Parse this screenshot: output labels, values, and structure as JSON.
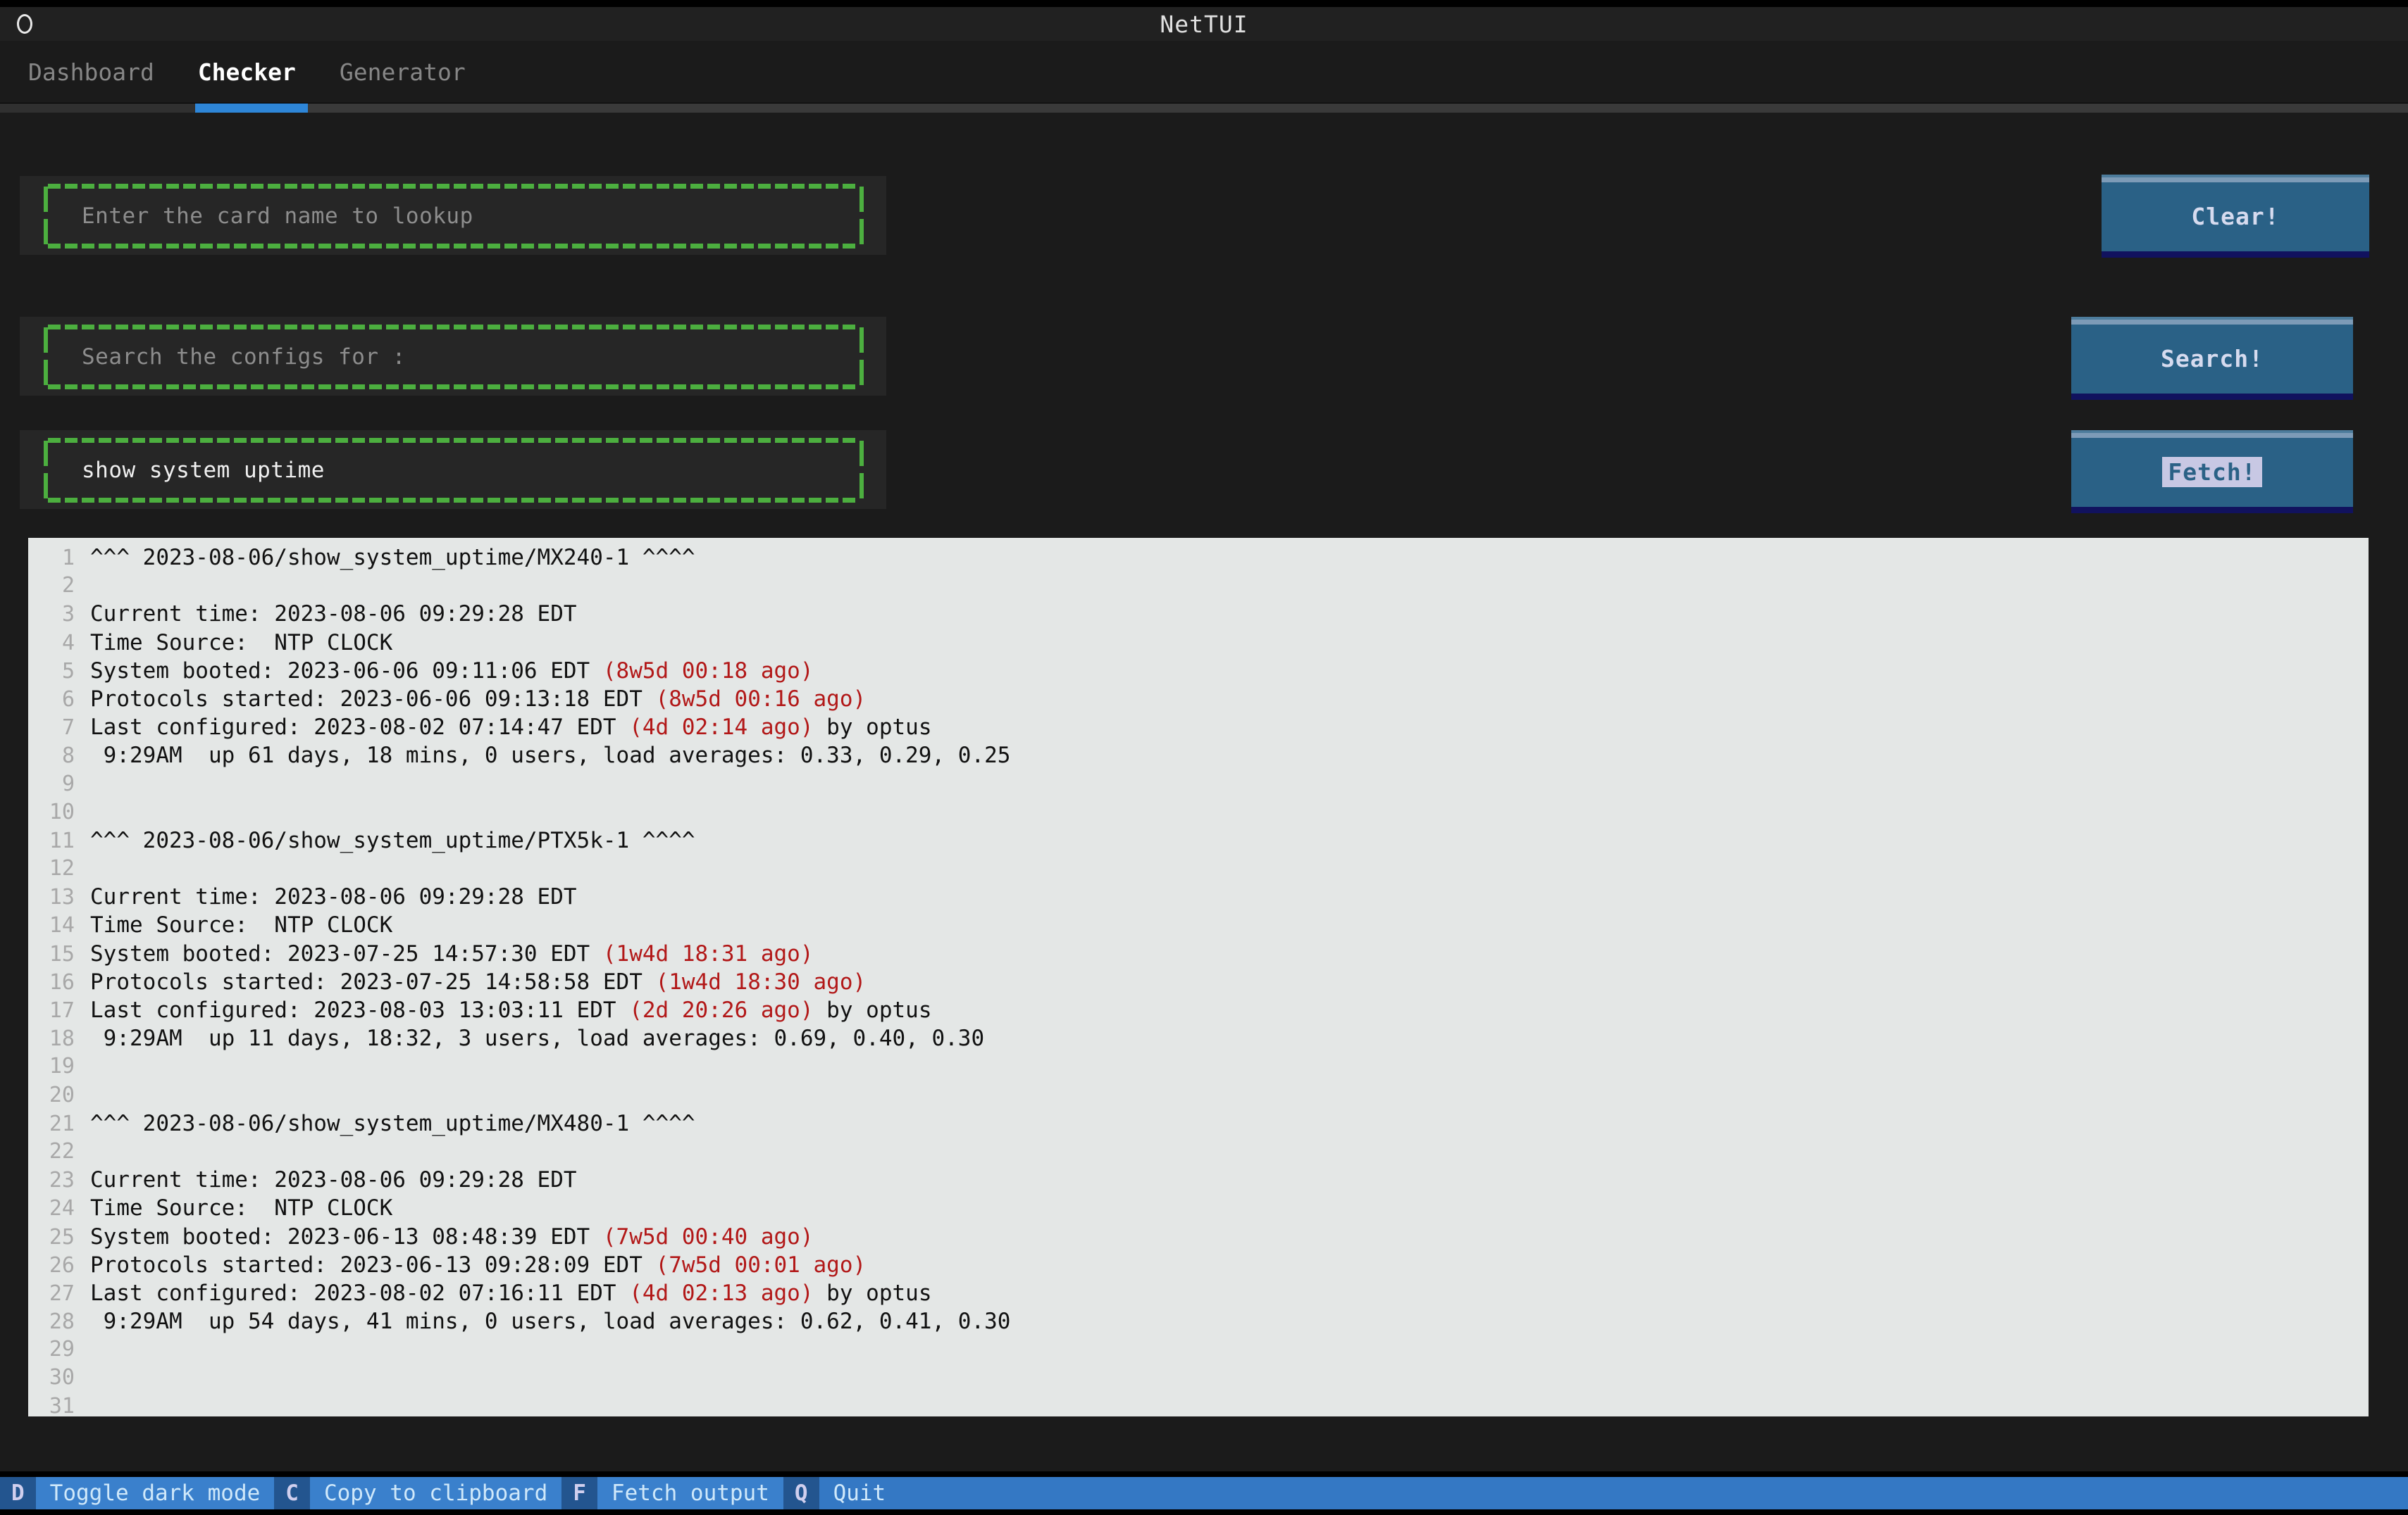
{
  "window": {
    "title": "NetTUI",
    "menu_icon": "circle-icon"
  },
  "tabs": [
    {
      "label": "Dashboard",
      "active": false
    },
    {
      "label": "Checker",
      "active": true
    },
    {
      "label": "Generator",
      "active": false
    }
  ],
  "inputs": [
    {
      "name": "card-name-input",
      "placeholder": "Enter the card name to lookup",
      "value": "",
      "is_placeholder": true
    },
    {
      "name": "config-search-input",
      "placeholder": "Search the configs for :",
      "value": "",
      "is_placeholder": true
    },
    {
      "name": "command-input",
      "placeholder": "",
      "value": "show system uptime",
      "is_placeholder": false
    }
  ],
  "buttons": [
    {
      "label": "Clear!",
      "highlighted": false
    },
    {
      "label": "Search!",
      "highlighted": false
    },
    {
      "label": "Fetch!",
      "highlighted": true
    }
  ],
  "colors": {
    "accent_blue": "#2e86d8",
    "button_blue": "#2a6186",
    "border_green": "#4caf3f",
    "footer_blue": "#3478c4",
    "output_bg": "#e4e7e6",
    "red_annotation": "#b21818"
  },
  "output": {
    "lines": [
      {
        "n": "1",
        "segs": [
          {
            "t": "^^^ 2023-08-06/show_system_uptime/MX240-1 ^^^^",
            "c": "n"
          }
        ]
      },
      {
        "n": "2",
        "segs": []
      },
      {
        "n": "3",
        "segs": [
          {
            "t": "Current time: 2023-08-06 09:29:28 EDT",
            "c": "n"
          }
        ]
      },
      {
        "n": "4",
        "segs": [
          {
            "t": "Time Source:  NTP CLOCK",
            "c": "n"
          }
        ]
      },
      {
        "n": "5",
        "segs": [
          {
            "t": "System booted: 2023-06-06 09:11:06 EDT ",
            "c": "n"
          },
          {
            "t": "(8w5d 00:18 ago)",
            "c": "r"
          }
        ]
      },
      {
        "n": "6",
        "segs": [
          {
            "t": "Protocols started: 2023-06-06 09:13:18 EDT ",
            "c": "n"
          },
          {
            "t": "(8w5d 00:16 ago)",
            "c": "r"
          }
        ]
      },
      {
        "n": "7",
        "segs": [
          {
            "t": "Last configured: 2023-08-02 07:14:47 EDT ",
            "c": "n"
          },
          {
            "t": "(4d 02:14 ago)",
            "c": "r"
          },
          {
            "t": " by optus",
            "c": "n"
          }
        ]
      },
      {
        "n": "8",
        "segs": [
          {
            "t": " 9:29AM  up 61 days, 18 mins, 0 users, load averages: 0.33, 0.29, 0.25",
            "c": "n"
          }
        ]
      },
      {
        "n": "9",
        "segs": []
      },
      {
        "n": "10",
        "segs": []
      },
      {
        "n": "11",
        "segs": [
          {
            "t": "^^^ 2023-08-06/show_system_uptime/PTX5k-1 ^^^^",
            "c": "n"
          }
        ]
      },
      {
        "n": "12",
        "segs": []
      },
      {
        "n": "13",
        "segs": [
          {
            "t": "Current time: 2023-08-06 09:29:28 EDT",
            "c": "n"
          }
        ]
      },
      {
        "n": "14",
        "segs": [
          {
            "t": "Time Source:  NTP CLOCK",
            "c": "n"
          }
        ]
      },
      {
        "n": "15",
        "segs": [
          {
            "t": "System booted: 2023-07-25 14:57:30 EDT ",
            "c": "n"
          },
          {
            "t": "(1w4d 18:31 ago)",
            "c": "r"
          }
        ]
      },
      {
        "n": "16",
        "segs": [
          {
            "t": "Protocols started: 2023-07-25 14:58:58 EDT ",
            "c": "n"
          },
          {
            "t": "(1w4d 18:30 ago)",
            "c": "r"
          }
        ]
      },
      {
        "n": "17",
        "segs": [
          {
            "t": "Last configured: 2023-08-03 13:03:11 EDT ",
            "c": "n"
          },
          {
            "t": "(2d 20:26 ago)",
            "c": "r"
          },
          {
            "t": " by optus",
            "c": "n"
          }
        ]
      },
      {
        "n": "18",
        "segs": [
          {
            "t": " 9:29AM  up 11 days, 18:32, 3 users, load averages: 0.69, 0.40, 0.30",
            "c": "n"
          }
        ]
      },
      {
        "n": "19",
        "segs": []
      },
      {
        "n": "20",
        "segs": []
      },
      {
        "n": "21",
        "segs": [
          {
            "t": "^^^ 2023-08-06/show_system_uptime/MX480-1 ^^^^",
            "c": "n"
          }
        ]
      },
      {
        "n": "22",
        "segs": []
      },
      {
        "n": "23",
        "segs": [
          {
            "t": "Current time: 2023-08-06 09:29:28 EDT",
            "c": "n"
          }
        ]
      },
      {
        "n": "24",
        "segs": [
          {
            "t": "Time Source:  NTP CLOCK",
            "c": "n"
          }
        ]
      },
      {
        "n": "25",
        "segs": [
          {
            "t": "System booted: 2023-06-13 08:48:39 EDT ",
            "c": "n"
          },
          {
            "t": "(7w5d 00:40 ago)",
            "c": "r"
          }
        ]
      },
      {
        "n": "26",
        "segs": [
          {
            "t": "Protocols started: 2023-06-13 09:28:09 EDT ",
            "c": "n"
          },
          {
            "t": "(7w5d 00:01 ago)",
            "c": "r"
          }
        ]
      },
      {
        "n": "27",
        "segs": [
          {
            "t": "Last configured: 2023-08-02 07:16:11 EDT ",
            "c": "n"
          },
          {
            "t": "(4d 02:13 ago)",
            "c": "r"
          },
          {
            "t": " by optus",
            "c": "n"
          }
        ]
      },
      {
        "n": "28",
        "segs": [
          {
            "t": " 9:29AM  up 54 days, 41 mins, 0 users, load averages: 0.62, 0.41, 0.30",
            "c": "n"
          }
        ]
      },
      {
        "n": "29",
        "segs": []
      },
      {
        "n": "30",
        "segs": []
      },
      {
        "n": "31",
        "segs": []
      }
    ]
  },
  "footer": {
    "bindings": [
      {
        "key": "D",
        "desc": "Toggle dark mode"
      },
      {
        "key": "C",
        "desc": "Copy to clipboard"
      },
      {
        "key": "F",
        "desc": "Fetch output"
      },
      {
        "key": "Q",
        "desc": "Quit"
      }
    ]
  }
}
